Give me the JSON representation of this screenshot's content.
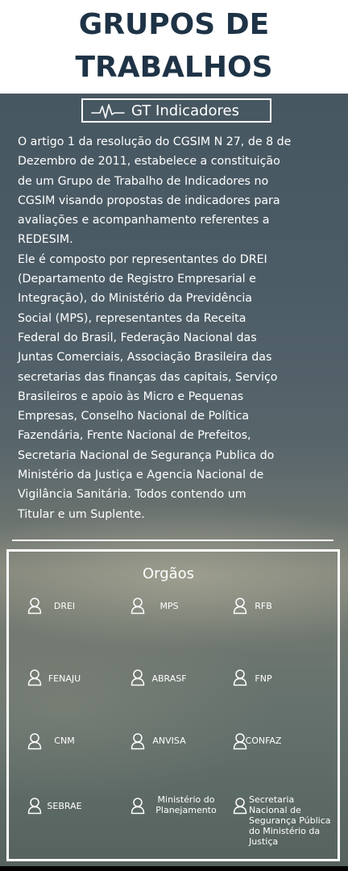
{
  "header": {
    "title_line1": "GRUPOS DE",
    "title_line2": "TRABALHOS"
  },
  "gt": {
    "icon": "heartbeat-icon",
    "label": "GT Indicadores"
  },
  "description": {
    "lines": [
      "O artigo 1 da resolução do CGSIM N 27, de 8 de",
      "Dezembro de 2011, estabelece a constituição",
      "de um Grupo de Trabalho de Indicadores no",
      "CGSIM visando propostas de indicadores para",
      "avaliações e acompanhamento referentes a",
      "REDESIM.",
      "Ele é composto por representantes do DREI",
      "(Departamento de Registro Empresarial e",
      "Integração), do Ministério da Previdência",
      "Social (MPS),  representantes da Receita",
      "Federal do Brasil, Federação Nacional das",
      "Juntas Comerciais, Associação Brasileira das",
      "secretarias das finanças das capitais, Serviço",
      "Brasileiros e apoio às Micro e Pequenas",
      "Empresas, Conselho Nacional de Política",
      "Fazendária, Frente Nacional de Prefeitos,",
      "Secretaria Nacional de Segurança Publica do",
      "Ministério da Justiça e Agencia Nacional de",
      "Vigilância Sanitária. Todos contendo um",
      "Titular e um Suplente."
    ]
  },
  "orgs": {
    "title": "Orgaos",
    "items": [
      {
        "label": "DREI",
        "icon": "user-icon"
      },
      {
        "label": "MPS",
        "icon": "user-icon"
      },
      {
        "label": "RFB",
        "icon": "user-icon"
      },
      {
        "label": "FENAJU",
        "icon": "user-icon"
      },
      {
        "label": "ABRASF",
        "icon": "user-icon"
      },
      {
        "label": "FNP",
        "icon": "user-icon"
      },
      {
        "label": "CNM",
        "icon": "user-icon"
      },
      {
        "label": "ANVISA",
        "icon": "user-icon"
      },
      {
        "label": "CONFAZ",
        "icon": "user-icon"
      },
      {
        "label": "SEBRAE",
        "icon": "user-icon"
      },
      {
        "label_lines": [
          "Ministério do",
          "Planejamento"
        ],
        "icon": "user-icon"
      },
      {
        "label_lines": [
          "Secretaria",
          "Nacional de",
          "Segurança Pública",
          "do Ministério da",
          "Justiça"
        ],
        "icon": "user-icon"
      }
    ]
  },
  "colors": {
    "title": "#1e3346",
    "header_bg": "#ffffff",
    "text": "#ffffff"
  }
}
